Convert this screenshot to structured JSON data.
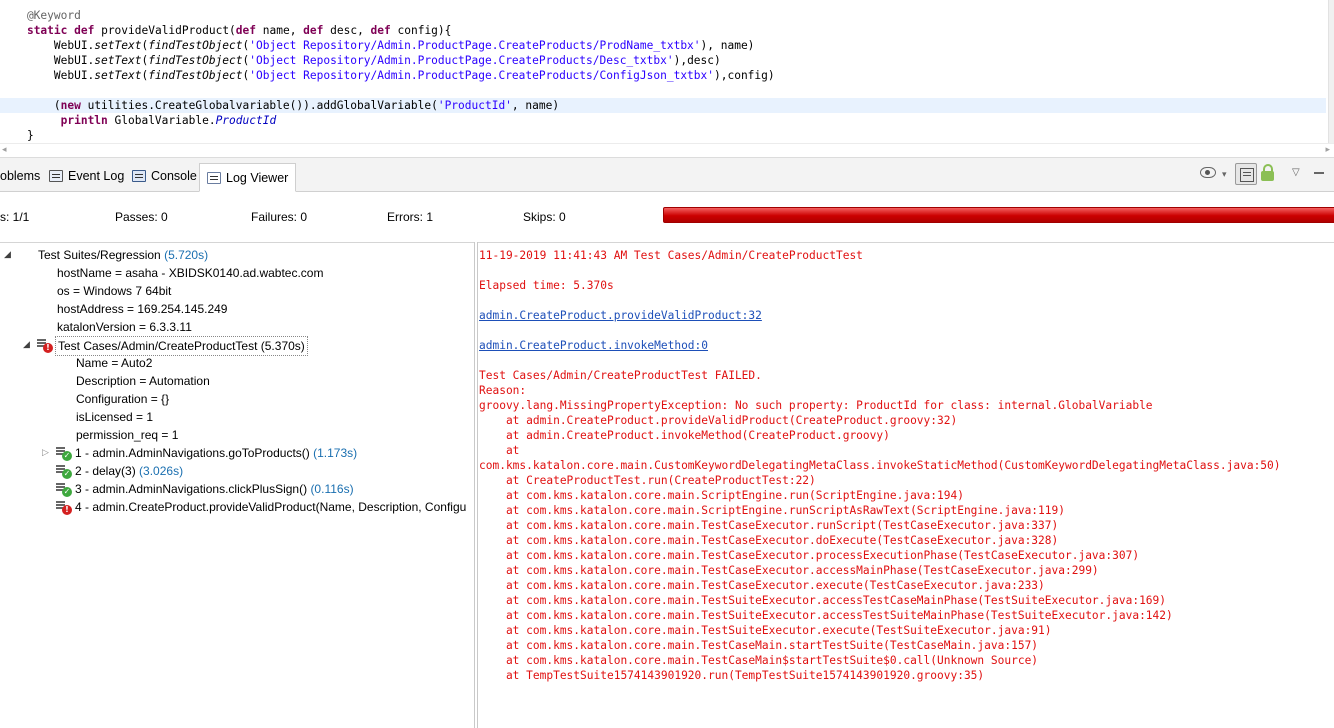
{
  "editor": {
    "lines": [
      "    @Keyword",
      "    static def provideValidProduct(def name, def desc, def config){",
      "        WebUI.setText(findTestObject('Object Repository/Admin.ProductPage.CreateProducts/ProdName_txtbx'), name)",
      "        WebUI.setText(findTestObject('Object Repository/Admin.ProductPage.CreateProducts/Desc_txtbx'),desc)",
      "        WebUI.setText(findTestObject('Object Repository/Admin.ProductPage.CreateProducts/ConfigJson_txtbx'),config)",
      "",
      "        (new utilities.CreateGlobalvariable()).addGlobalVariable('ProductId', name)",
      "         println GlobalVariable.ProductId",
      "    }"
    ],
    "scroll_left": "◂",
    "scroll_right": "▸"
  },
  "tabs": [
    {
      "label": "oblems",
      "icon": "problems-icon"
    },
    {
      "label": "Event Log",
      "icon": "event-log-icon"
    },
    {
      "label": "Console",
      "icon": "console-icon"
    },
    {
      "label": "Log Viewer",
      "icon": "log-viewer-icon",
      "active": true
    }
  ],
  "toolbar": {
    "dropdown_glyph": "▾",
    "menu_glyph": "▽"
  },
  "summary": {
    "runs": "s: 1/1",
    "passes": "Passes:  0",
    "failures": "Failures:  0",
    "errors": "Errors:  1",
    "skips": "Skips:  0",
    "progress_fraction": 1.0,
    "progress_color": "#cc0000"
  },
  "tree": {
    "root": {
      "label": "Test Suites/Regression",
      "duration": "(5.720s)",
      "twisty": "◢"
    },
    "properties": [
      "hostName = asaha - XBIDSK0140.ad.wabtec.com",
      "os = Windows 7 64bit",
      "hostAddress = 169.254.145.249",
      "katalonVersion = 6.3.3.11"
    ],
    "testcase": {
      "label": "Test Cases/Admin/CreateProductTest",
      "duration": "(5.370s)",
      "twisty": "◢",
      "status": "error"
    },
    "tc_properties": [
      "Name = Auto2",
      "Description = Automation",
      "Configuration = {}",
      "isLicensed = 1",
      "permission_req = 1"
    ],
    "steps": [
      {
        "label": "1 - admin.AdminNavigations.goToProducts()",
        "duration": "(1.173s)",
        "status": "pass",
        "twisty": "▷"
      },
      {
        "label": "2 - delay(3)",
        "duration": "(3.026s)",
        "status": "pass",
        "twisty": ""
      },
      {
        "label": "3 - admin.AdminNavigations.clickPlusSign()",
        "duration": "(0.116s)",
        "status": "pass",
        "twisty": ""
      },
      {
        "label": "4 - admin.CreateProduct.provideValidProduct(Name, Description, Configu",
        "duration": "",
        "status": "error",
        "twisty": ""
      }
    ]
  },
  "log": {
    "header": "11-19-2019 11:41:43 AM Test Cases/Admin/CreateProductTest",
    "elapsed": "Elapsed time: 5.370s",
    "link1": "admin.CreateProduct.provideValidProduct:32",
    "link2": "admin.CreateProduct.invokeMethod:0",
    "trace": [
      "Test Cases/Admin/CreateProductTest FAILED.",
      "Reason:",
      "groovy.lang.MissingPropertyException: No such property: ProductId for class: internal.GlobalVariable",
      "    at admin.CreateProduct.provideValidProduct(CreateProduct.groovy:32)",
      "    at admin.CreateProduct.invokeMethod(CreateProduct.groovy)",
      "    at",
      "com.kms.katalon.core.main.CustomKeywordDelegatingMetaClass.invokeStaticMethod(CustomKeywordDelegatingMetaClass.java:50)",
      "    at CreateProductTest.run(CreateProductTest:22)",
      "    at com.kms.katalon.core.main.ScriptEngine.run(ScriptEngine.java:194)",
      "    at com.kms.katalon.core.main.ScriptEngine.runScriptAsRawText(ScriptEngine.java:119)",
      "    at com.kms.katalon.core.main.TestCaseExecutor.runScript(TestCaseExecutor.java:337)",
      "    at com.kms.katalon.core.main.TestCaseExecutor.doExecute(TestCaseExecutor.java:328)",
      "    at com.kms.katalon.core.main.TestCaseExecutor.processExecutionPhase(TestCaseExecutor.java:307)",
      "    at com.kms.katalon.core.main.TestCaseExecutor.accessMainPhase(TestCaseExecutor.java:299)",
      "    at com.kms.katalon.core.main.TestCaseExecutor.execute(TestCaseExecutor.java:233)",
      "    at com.kms.katalon.core.main.TestSuiteExecutor.accessTestCaseMainPhase(TestSuiteExecutor.java:169)",
      "    at com.kms.katalon.core.main.TestSuiteExecutor.accessTestSuiteMainPhase(TestSuiteExecutor.java:142)",
      "    at com.kms.katalon.core.main.TestSuiteExecutor.execute(TestSuiteExecutor.java:91)",
      "    at com.kms.katalon.core.main.TestCaseMain.startTestSuite(TestCaseMain.java:157)",
      "    at com.kms.katalon.core.main.TestCaseMain$startTestSuite$0.call(Unknown Source)",
      "    at TempTestSuite1574143901920.run(TempTestSuite1574143901920.groovy:35)"
    ]
  }
}
